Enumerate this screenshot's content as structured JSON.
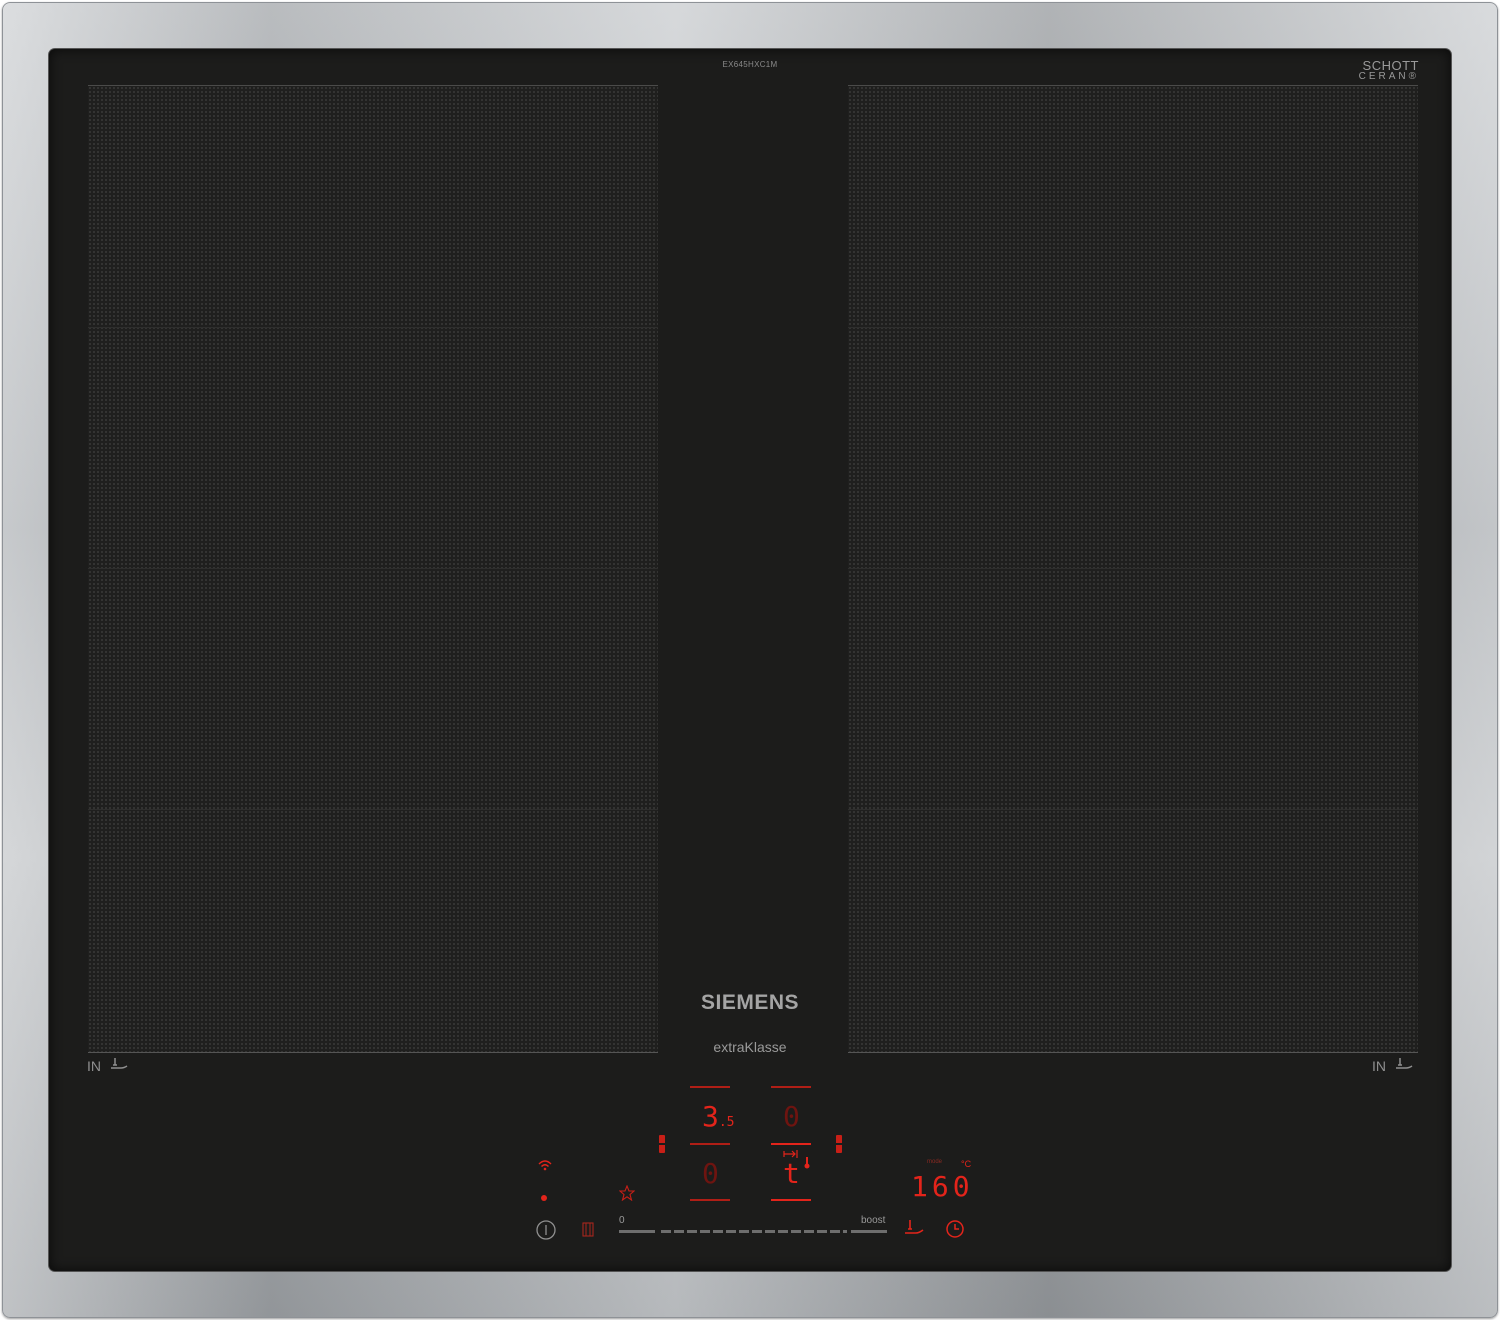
{
  "appliance": {
    "model_code": "EX645HXC1M",
    "glass_brand_line1": "SCHOTT",
    "glass_brand_line2": "CERAN®",
    "brand": "SIEMENS",
    "series_prefix": "extra",
    "series_suffix": "Klasse",
    "flex_zone_label_left": "IN",
    "flex_zone_label_right": "IN"
  },
  "controls": {
    "zone_front_left_level": "3",
    "zone_front_left_decimal": ".5",
    "zone_rear_left_level": "0",
    "zone_front_right_level": "0",
    "zone_rear_right_level": "t",
    "slider_min_label": "0",
    "boost_label": "boost",
    "pan_temperature": "160",
    "temperature_unit": "°C",
    "temperature_mode_label": "mode"
  },
  "colors": {
    "display_red": "#e3241b",
    "glass": "#1c1c1b",
    "frame": "#b5b8bb"
  },
  "icons": {
    "wifi": "wifi-icon",
    "home_connect_dot": "status-dot-icon",
    "favorite": "star-icon",
    "power": "power-icon",
    "lock": "child-lock-icon",
    "frying_sensor": "frying-sensor-icon",
    "timer": "timer-icon"
  }
}
